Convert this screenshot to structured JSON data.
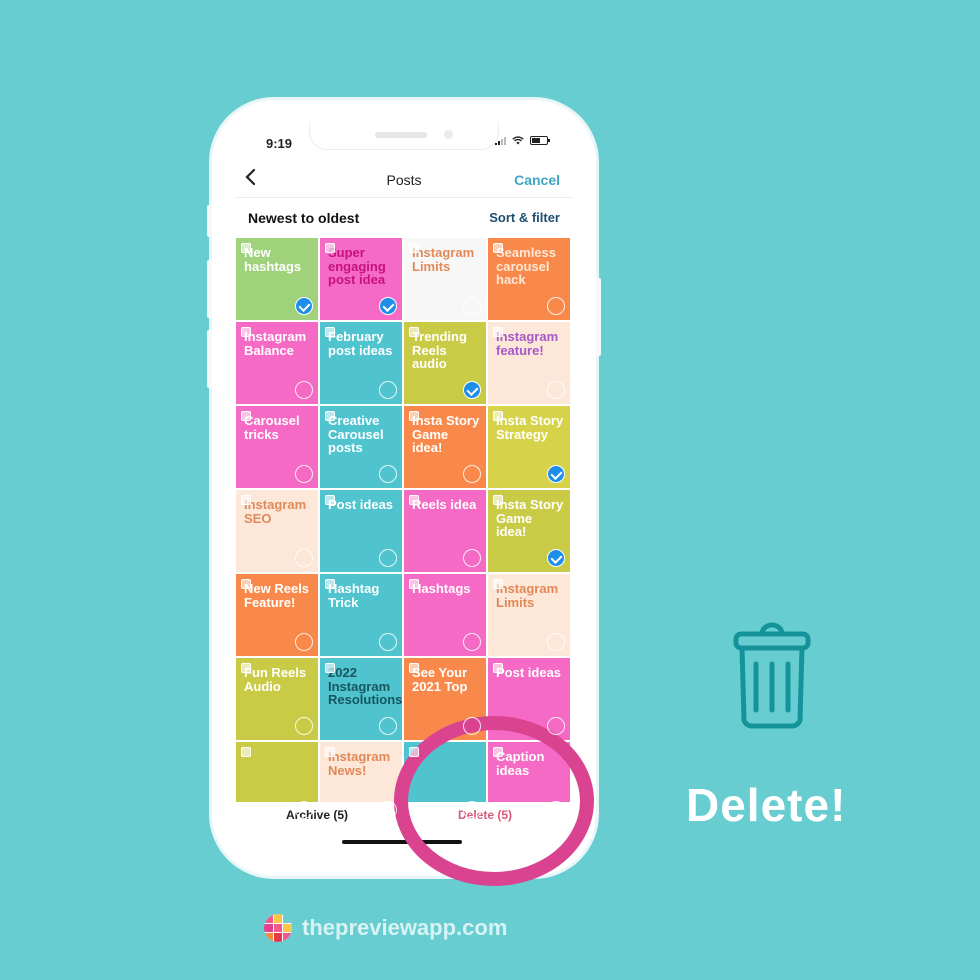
{
  "status_bar": {
    "time": "9:19"
  },
  "nav": {
    "back_label": "‹",
    "title": "Posts",
    "cancel_label": "Cancel"
  },
  "sort": {
    "label": "Newest to oldest",
    "button_label": "Sort & filter"
  },
  "posts": [
    {
      "text": "New hashtags",
      "bg": "#9fd27a",
      "fg": "#ffffff",
      "selected": true
    },
    {
      "text": "Super engaging post idea",
      "bg": "#f56ac4",
      "fg": "#c7117f",
      "selected": true
    },
    {
      "text": "Instagram Limits",
      "bg": "#f7f7f7",
      "fg": "#e08a5a",
      "selected": false
    },
    {
      "text": "Seamless carousel hack",
      "bg": "#f9894a",
      "fg": "#ffe7d6",
      "selected": false
    },
    {
      "text": "Instagram Balance",
      "bg": "#f56ac4",
      "fg": "#ffffff",
      "selected": false
    },
    {
      "text": "February post ideas",
      "bg": "#4fc4cf",
      "fg": "#ffffff",
      "selected": false
    },
    {
      "text": "Trending Reels audio",
      "bg": "#c9cb46",
      "fg": "#ffffff",
      "selected": true
    },
    {
      "text": "Instagram feature!",
      "bg": "#fce7d8",
      "fg": "#a659c7",
      "selected": false
    },
    {
      "text": "Carousel tricks",
      "bg": "#f56ac4",
      "fg": "#ffffff",
      "selected": false
    },
    {
      "text": "Creative Carousel posts",
      "bg": "#4fc4cf",
      "fg": "#ffffff",
      "selected": false
    },
    {
      "text": "Insta Story Game idea!",
      "bg": "#f9894a",
      "fg": "#ffffff",
      "selected": false
    },
    {
      "text": "Insta Story Strategy",
      "bg": "#d6d24a",
      "fg": "#ffffff",
      "selected": true
    },
    {
      "text": "Instagram SEO",
      "bg": "#fce7d8",
      "fg": "#e08a5a",
      "selected": false
    },
    {
      "text": "Post ideas",
      "bg": "#4fc4cf",
      "fg": "#ffffff",
      "selected": false
    },
    {
      "text": "Reels idea",
      "bg": "#f56ac4",
      "fg": "#ffffff",
      "selected": false
    },
    {
      "text": "Insta Story Game idea!",
      "bg": "#c9cb46",
      "fg": "#ffffff",
      "selected": true
    },
    {
      "text": "New Reels Feature!",
      "bg": "#f9894a",
      "fg": "#ffffff",
      "selected": false
    },
    {
      "text": "Hashtag Trick",
      "bg": "#4fc4cf",
      "fg": "#ffffff",
      "selected": false
    },
    {
      "text": "Hashtags",
      "bg": "#f56ac4",
      "fg": "#ffffff",
      "selected": false
    },
    {
      "text": "Instagram Limits",
      "bg": "#fce7d8",
      "fg": "#e08a5a",
      "selected": false
    },
    {
      "text": "Fun Reels Audio",
      "bg": "#c9cb46",
      "fg": "#ffffff",
      "selected": false
    },
    {
      "text": "2022 Instagram Resolutions",
      "bg": "#4fc4cf",
      "fg": "#17565f",
      "selected": false
    },
    {
      "text": "See Your 2021 Top",
      "bg": "#f9894a",
      "fg": "#ffffff",
      "selected": false
    },
    {
      "text": "Post ideas",
      "bg": "#f56ac4",
      "fg": "#ffffff",
      "selected": false
    },
    {
      "text": "",
      "bg": "#c9cb46",
      "fg": "#ffffff",
      "selected": false
    },
    {
      "text": "Instagram News!",
      "bg": "#fce7d8",
      "fg": "#e08a5a",
      "selected": false
    },
    {
      "text": "",
      "bg": "#4fc4cf",
      "fg": "#ffffff",
      "selected": false
    },
    {
      "text": "Caption ideas",
      "bg": "#f56ac4",
      "fg": "#ffffff",
      "selected": false
    }
  ],
  "bottom_bar": {
    "archive_label": "Archive (5)",
    "delete_label": "Delete (5)"
  },
  "callout": {
    "label": "Delete!",
    "icon": "trash-icon"
  },
  "footer": {
    "site": "thepreviewapp.com"
  },
  "colors": {
    "background": "#67cdd0",
    "accent_ring": "#d9438f",
    "delete": "#d9587a",
    "cancel": "#3fa5c5",
    "selected_check": "#1f8ee8"
  }
}
